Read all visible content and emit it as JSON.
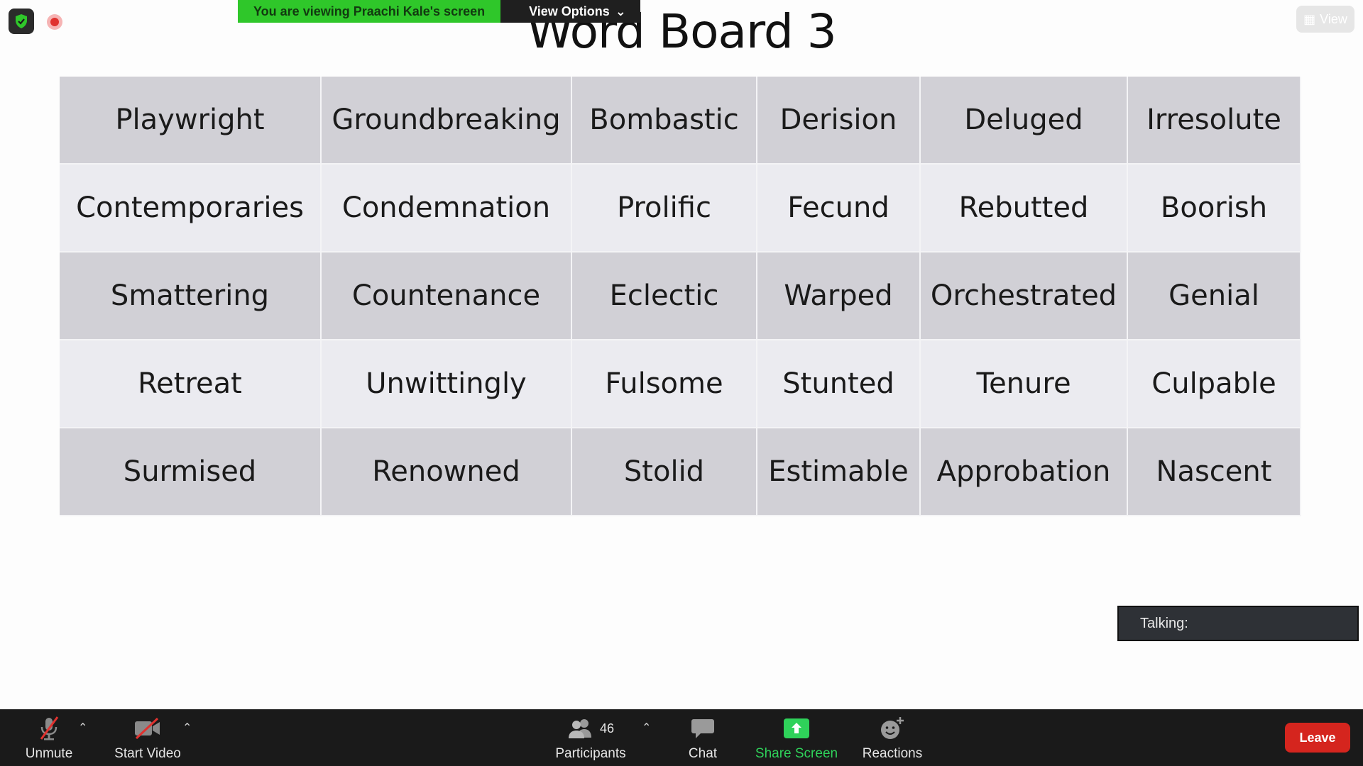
{
  "banner": {
    "viewing_text": "You are viewing Praachi Kale's screen",
    "view_options_label": "View Options"
  },
  "view_button_label": "View",
  "slide": {
    "title": "Word Board 3",
    "rows": [
      [
        "Playwright",
        "Groundbreaking",
        "Bombastic",
        "Derision",
        "Deluged",
        "Irresolute"
      ],
      [
        "Contemporaries",
        "Condemnation",
        "Prolific",
        "Fecund",
        "Rebutted",
        "Boorish"
      ],
      [
        "Smattering",
        "Countenance",
        "Eclectic",
        "Warped",
        "Orchestrated",
        "Genial"
      ],
      [
        "Retreat",
        "Unwittingly",
        "Fulsome",
        "Stunted",
        "Tenure",
        "Culpable"
      ],
      [
        "Surmised",
        "Renowned",
        "Stolid",
        "Estimable",
        "Approbation",
        "Nascent"
      ]
    ]
  },
  "talking_label": "Talking:",
  "toolbar": {
    "unmute_label": "Unmute",
    "start_video_label": "Start Video",
    "participants_label": "Participants",
    "participants_count": "46",
    "chat_label": "Chat",
    "share_screen_label": "Share Screen",
    "reactions_label": "Reactions",
    "leave_label": "Leave"
  },
  "colors": {
    "share_green": "#2fc72a",
    "leave_red": "#d5251e",
    "toolbar_bg": "#1a1a1a",
    "cell_dark": "#d1d0d6",
    "cell_light": "#ebebf0"
  }
}
